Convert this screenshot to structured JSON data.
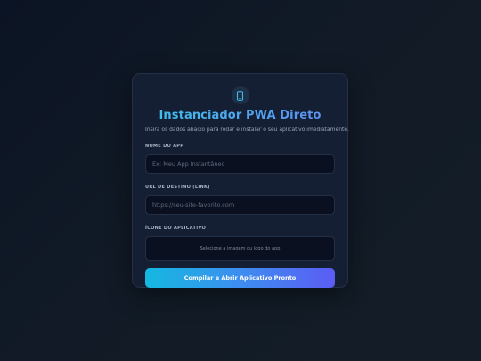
{
  "app": {
    "icon": "mobile-phone-icon",
    "title": "Instanciador PWA Direto",
    "subtitle": "Insira os dados abaixo para rodar e instalar o seu aplicativo imediatamente."
  },
  "form": {
    "name_label": "NOME DO APP",
    "name_placeholder": "Ex: Meu App Instantâneo",
    "name_value": "",
    "url_label": "URL DE DESTINO (LINK)",
    "url_placeholder": "https://seu-site-favorito.com",
    "url_value": "",
    "icon_label": "ÍCONE DO APLICATIVO",
    "icon_upload_text": "Selecione a imagem ou logo do app",
    "submit_label": "Compilar e Abrir Aplicativo Pronto"
  },
  "colors": {
    "accent_cyan": "#14b8e0",
    "accent_violet": "#5b5cf4",
    "title_blue": "#4ab0ec",
    "card_bg": "#141f33",
    "input_bg": "#0a1020"
  }
}
